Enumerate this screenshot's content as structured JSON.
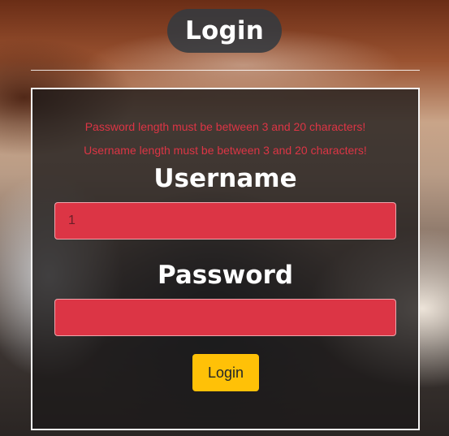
{
  "page": {
    "title": "Login"
  },
  "form": {
    "errors": [
      "Password length must be between 3 and 20 characters!",
      "Username length must be between 3 and 20 characters!"
    ],
    "username_label": "Username",
    "username_value": "1",
    "password_label": "Password",
    "password_value": "",
    "submit_label": "Login"
  },
  "colors": {
    "title_pill_bg": "#343a40",
    "error_text": "#dc3545",
    "invalid_field_bg": "#dc3545",
    "submit_button_bg": "#ffc107",
    "card_border": "#f5f5f5"
  }
}
